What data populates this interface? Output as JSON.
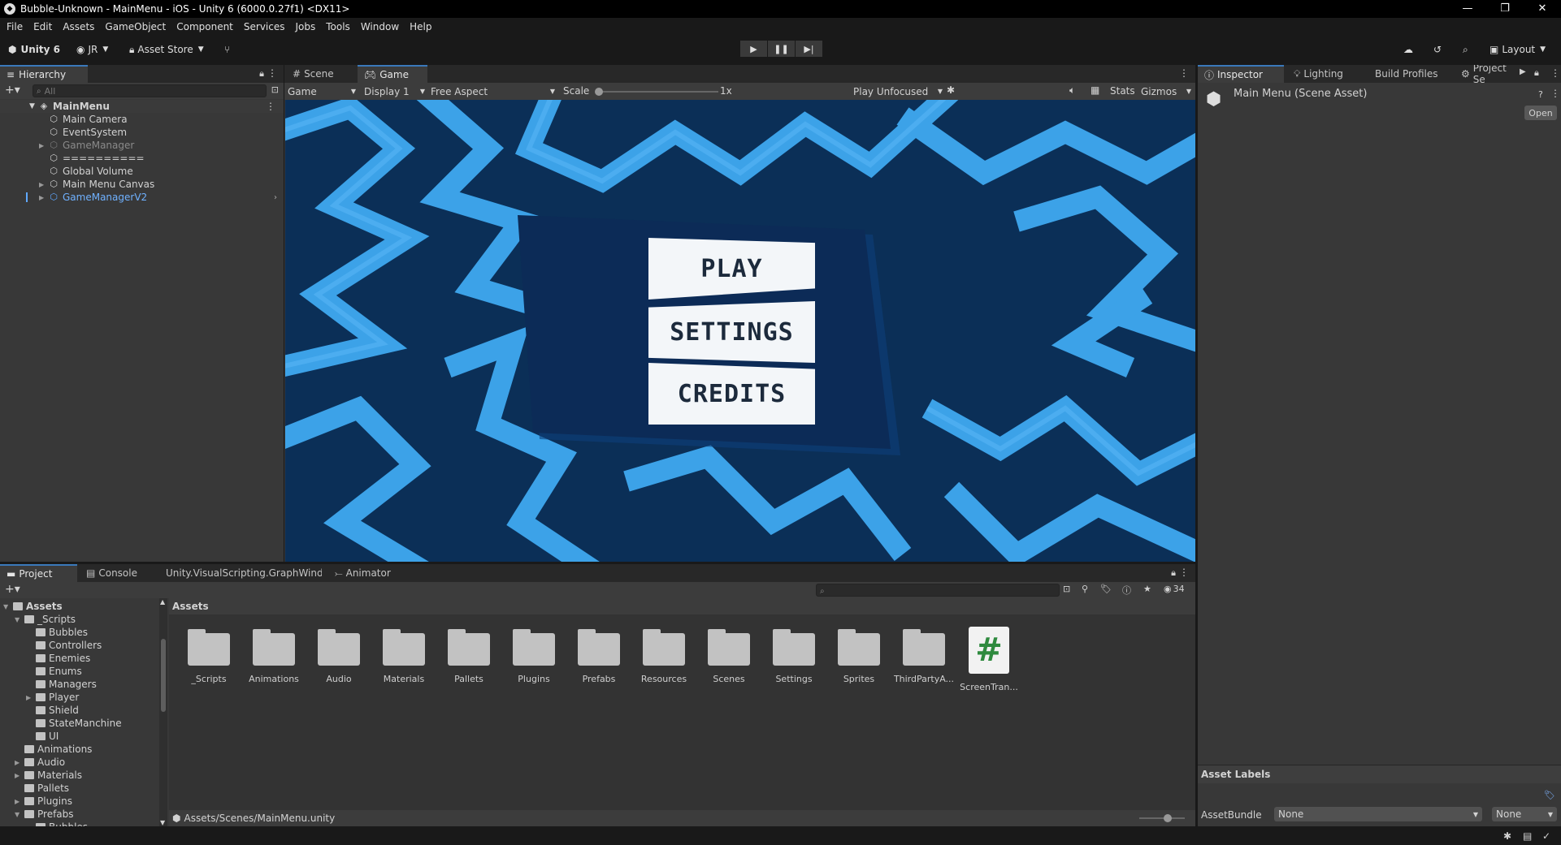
{
  "window": {
    "title": "Bubble-Unknown - MainMenu - iOS - Unity 6 (6000.0.27f1) <DX11>",
    "controls": [
      "—",
      "❐",
      "✕"
    ]
  },
  "menubar": [
    "File",
    "Edit",
    "Assets",
    "GameObject",
    "Component",
    "Services",
    "Jobs",
    "Tools",
    "Window",
    "Help"
  ],
  "toolbar": {
    "unity_label": "Unity 6",
    "account": "JR",
    "asset_store": "Asset Store",
    "layout": "Layout"
  },
  "hierarchy": {
    "tab": "Hierarchy",
    "search_placeholder": "All",
    "scene": "MainMenu",
    "items": [
      {
        "label": "Main Camera",
        "muted": false,
        "expandable": false,
        "selected_color": false
      },
      {
        "label": "EventSystem",
        "muted": false,
        "expandable": false,
        "selected_color": false
      },
      {
        "label": "GameManager",
        "muted": true,
        "expandable": true,
        "selected_color": false
      },
      {
        "label": "==========",
        "muted": false,
        "expandable": false,
        "selected_color": false
      },
      {
        "label": "Global Volume",
        "muted": false,
        "expandable": false,
        "selected_color": false
      },
      {
        "label": "Main Menu Canvas",
        "muted": false,
        "expandable": true,
        "selected_color": false
      },
      {
        "label": "GameManagerV2",
        "muted": false,
        "expandable": true,
        "selected_color": true
      }
    ]
  },
  "sceneview": {
    "tabs": [
      "Scene",
      "Game"
    ],
    "active_tab": "Game",
    "game_dropdown": "Game",
    "display_dropdown": "Display 1",
    "aspect_dropdown": "Free Aspect",
    "scale_label": "Scale",
    "scale_value": "1x",
    "play_mode": "Play Unfocused",
    "stats": "Stats",
    "gizmos": "Gizmos"
  },
  "game_menu": {
    "buttons": [
      "PLAY",
      "SETTINGS",
      "CREDITS"
    ]
  },
  "inspector": {
    "tabs": [
      "Inspector",
      "Lighting",
      "Build Profiles",
      "Project Se"
    ],
    "asset_title": "Main Menu (Scene Asset)",
    "open_button": "Open",
    "asset_labels": "Asset Labels",
    "assetbundle_label": "AssetBundle",
    "assetbundle_value": "None",
    "variant_value": "None"
  },
  "project": {
    "tabs": [
      "Project",
      "Console",
      "Unity.VisualScripting.GraphWindé",
      "Animator"
    ],
    "tree": [
      {
        "label": "Assets",
        "depth": 0,
        "bold": true,
        "arrow": "▼"
      },
      {
        "label": "_Scripts",
        "depth": 1,
        "bold": false,
        "arrow": "▼"
      },
      {
        "label": "Bubbles",
        "depth": 2,
        "bold": false,
        "arrow": ""
      },
      {
        "label": "Controllers",
        "depth": 2,
        "bold": false,
        "arrow": ""
      },
      {
        "label": "Enemies",
        "depth": 2,
        "bold": false,
        "arrow": ""
      },
      {
        "label": "Enums",
        "depth": 2,
        "bold": false,
        "arrow": ""
      },
      {
        "label": "Managers",
        "depth": 2,
        "bold": false,
        "arrow": ""
      },
      {
        "label": "Player",
        "depth": 2,
        "bold": false,
        "arrow": "▶"
      },
      {
        "label": "Shield",
        "depth": 2,
        "bold": false,
        "arrow": ""
      },
      {
        "label": "StateManchine",
        "depth": 2,
        "bold": false,
        "arrow": ""
      },
      {
        "label": "UI",
        "depth": 2,
        "bold": false,
        "arrow": ""
      },
      {
        "label": "Animations",
        "depth": 1,
        "bold": false,
        "arrow": ""
      },
      {
        "label": "Audio",
        "depth": 1,
        "bold": false,
        "arrow": "▶"
      },
      {
        "label": "Materials",
        "depth": 1,
        "bold": false,
        "arrow": "▶"
      },
      {
        "label": "Pallets",
        "depth": 1,
        "bold": false,
        "arrow": ""
      },
      {
        "label": "Plugins",
        "depth": 1,
        "bold": false,
        "arrow": "▶"
      },
      {
        "label": "Prefabs",
        "depth": 1,
        "bold": false,
        "arrow": "▼"
      },
      {
        "label": "Bubbles",
        "depth": 2,
        "bold": false,
        "arrow": ""
      }
    ],
    "breadcrumb": "Assets",
    "hidden_count": "34",
    "assets": [
      "_Scripts",
      "Animations",
      "Audio",
      "Materials",
      "Pallets",
      "Plugins",
      "Prefabs",
      "Resources",
      "Scenes",
      "Settings",
      "Sprites",
      "ThirdPartyA...",
      "ScreenTran..."
    ],
    "script_glyph": "#",
    "selected_path": "Assets/Scenes/MainMenu.unity"
  }
}
